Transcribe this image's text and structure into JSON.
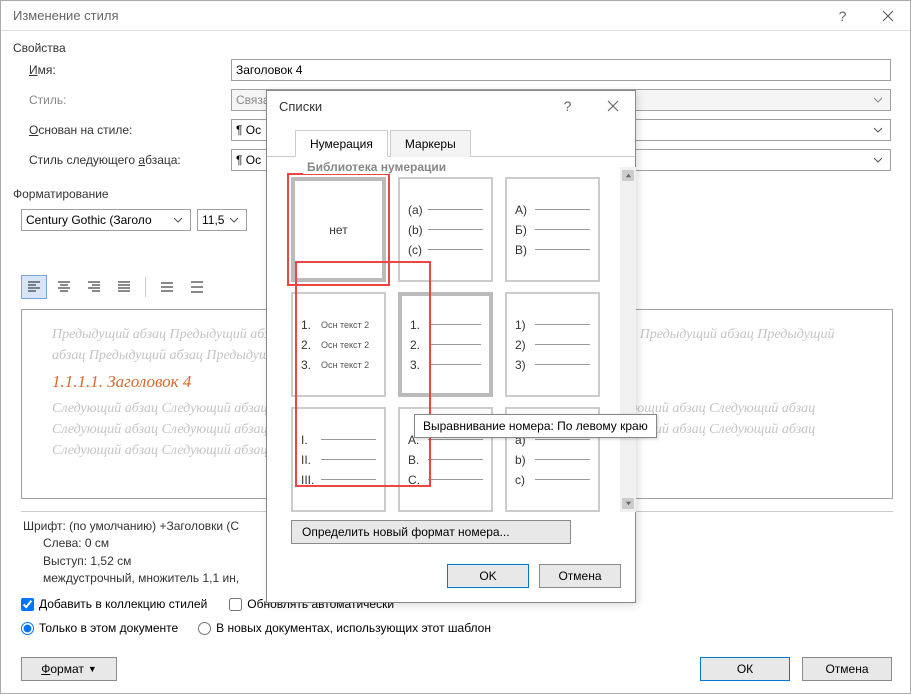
{
  "main": {
    "title": "Изменение стиля",
    "section_props": "Свойства",
    "name_label": "Имя:",
    "name_value": "Заголовок 4",
    "style_label": "Стиль:",
    "style_value": "Связа",
    "based_label": "Основан на стиле:",
    "based_value": "¶ Ос",
    "next_label": "Стиль следующего абзаца:",
    "next_value": "¶ Ос",
    "section_fmt": "Форматирование",
    "font_name": "Century Gothic (Заголо",
    "font_size": "11,5",
    "preview_ghost_before": "Предыдущий абзац Предыдущий абзац Предыдущий абзац Предыдущий абзац Предыдущий абзац Предыдущий абзац Предыдущий абзац Предыдущий абзац Предыдущий абзац Предыдущий абзац",
    "preview_sample": "1.1.1.1. Заголовок 4",
    "preview_ghost_after": "Следующий абзац Следующий абзац Следующий абзац Следующий абзац Следующий абзац Следующий абзац Следующий абзац Следующий абзац Следующий абзац Следующий абзац Следующий абзац Следующий абзац Следующий абзац Следующий абзац Следующий абзац Следующий абзац Следующий абзац Следующий абзац Следующий абзац",
    "desc_line1": "Шрифт: (по умолчанию) +Заголовки (C",
    "desc_line2": "Слева:  0 см",
    "desc_line3": "Выступ:  1,52 см",
    "desc_line4": "междустрочный,  множитель 1,1 ин, ",
    "chk_add": "Добавить в коллекцию стилей",
    "chk_auto": "Обновлять автоматически",
    "radio_thisdoc": "Только в этом документе",
    "radio_newdocs": "В новых документах, использующих этот шаблон",
    "format_btn": "Формат",
    "ok": "ОК",
    "cancel": "Отмена"
  },
  "lists": {
    "title": "Списки",
    "tab_num": "Нумерация",
    "tab_bul": "Маркеры",
    "lib_title": "Библиотека нумерации",
    "none": "нет",
    "card2": [
      "(a)",
      "(b)",
      "(c)"
    ],
    "card3": [
      "A)",
      "Б)",
      "B)"
    ],
    "card4_lbl": [
      "1.",
      "2.",
      "3."
    ],
    "card4_txt": "Осн текст 2",
    "card5": [
      "1.",
      "2.",
      "3."
    ],
    "card6": [
      "1)",
      "2)",
      "3)"
    ],
    "card7": [
      "I.",
      "II.",
      "III."
    ],
    "card8": [
      "A.",
      "B.",
      "C."
    ],
    "card9": [
      "a)",
      "b)",
      "c)"
    ],
    "tooltip": "Выравнивание номера: По левому краю",
    "define_btn": "Определить новый формат номера...",
    "ok": "OK",
    "cancel": "Отмена"
  }
}
